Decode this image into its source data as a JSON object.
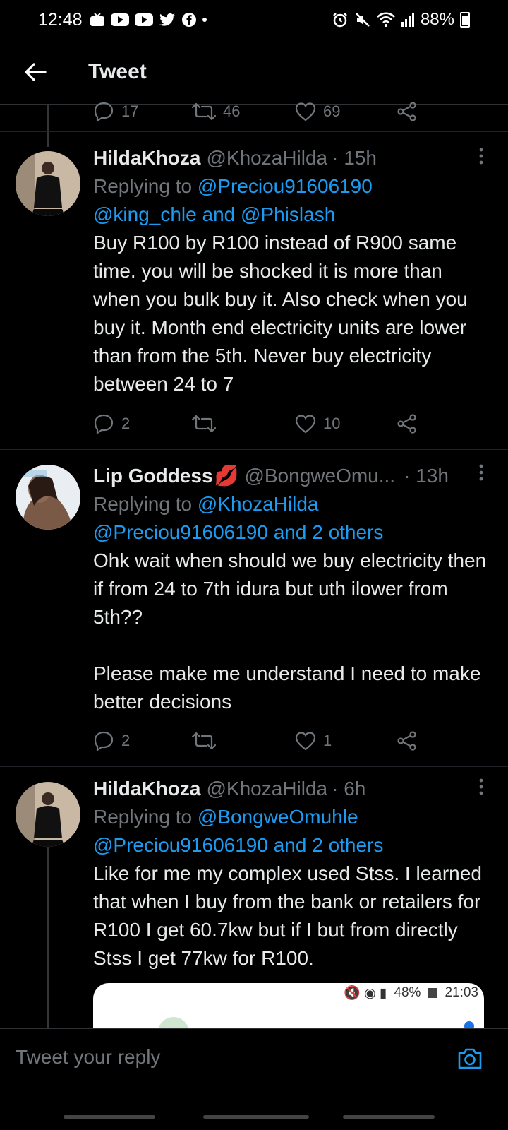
{
  "status_bar": {
    "time": "12:48",
    "battery": "88%",
    "left_icons": [
      "notification-icon",
      "youtube-icon",
      "youtube-icon",
      "twitter-icon",
      "facebook-icon",
      "dot-icon"
    ],
    "right_icons": [
      "alarm-icon",
      "mute-icon",
      "wifi-icon",
      "signal-icon",
      "battery-icon"
    ]
  },
  "header": {
    "title": "Tweet"
  },
  "top_actions": {
    "replies": "17",
    "retweets": "46",
    "likes": "69"
  },
  "tweets": [
    {
      "name": "HildaKhoza",
      "handle": "@KhozaHilda",
      "time": "· 15h",
      "replying_prefix": "Replying to ",
      "replying_line1": "@Preciou91606190",
      "replying_line2": "@king_chle and @Phislash",
      "text": "Buy R100 by R100 instead of R900 same time. you will be shocked it is more than when you bulk buy it. Also check when you buy it. Month end electricity units are lower than from the 5th. Never buy electricity between 24 to 7",
      "replies": "2",
      "retweets": "",
      "likes": "10"
    },
    {
      "name": "Lip Goddess",
      "emoji": "💋",
      "handle": "@BongweOmu...",
      "time": "· 13h",
      "replying_prefix": "Replying to ",
      "replying_line1": "@KhozaHilda",
      "replying_line2": "@Preciou91606190 and 2 others",
      "text": "Ohk wait when should we buy electricity then if from 24 to 7th idura but uth ilower from 5th??\n\nPlease make me understand I need to make better decisions",
      "replies": "2",
      "retweets": "",
      "likes": "1"
    },
    {
      "name": "HildaKhoza",
      "handle": "@KhozaHilda",
      "time": "· 6h",
      "replying_prefix": "Replying to ",
      "replying_line1": "@BongweOmuhle",
      "replying_line2": "@Preciou91606190 and 2 others",
      "text": "Like for me my complex used Stss. I learned that when I buy from the bank or retailers for R100 I get 60.7kw but if I but from directly Stss I get 77kw for R100."
    }
  ],
  "embedded_screenshot": {
    "battery": "48%",
    "time": "21:03"
  },
  "reply_bar": {
    "placeholder": "Tweet your reply"
  },
  "colors": {
    "background": "#000000",
    "link": "#1d9bf0",
    "muted": "#71767b",
    "text": "#e7e9ea"
  }
}
